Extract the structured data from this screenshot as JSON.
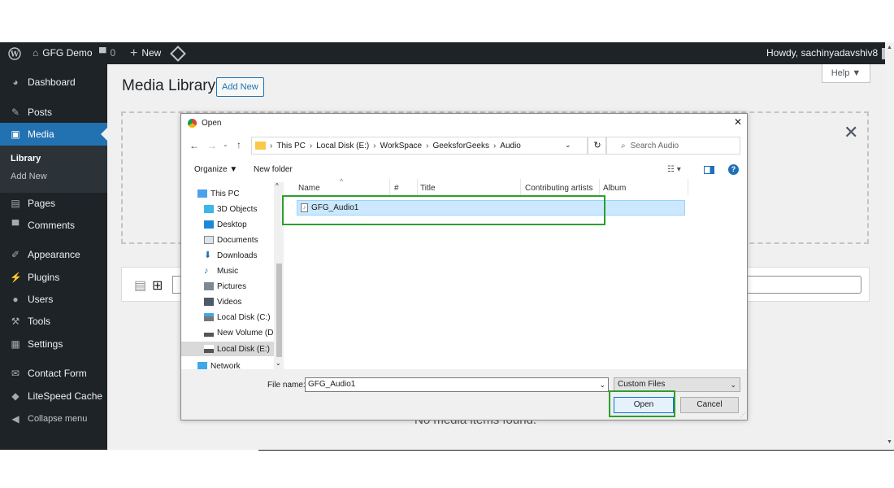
{
  "adminbar": {
    "site_name": "GFG Demo",
    "comments_count": "0",
    "new_label": "New",
    "howdy": "Howdy, sachinyadavshiv8"
  },
  "sidebar": {
    "items": [
      {
        "label": "Dashboard",
        "icon": "dashboard-icon"
      },
      {
        "label": "Posts",
        "icon": "pin-icon"
      },
      {
        "label": "Media",
        "icon": "media-icon"
      },
      {
        "label": "Pages",
        "icon": "pages-icon"
      },
      {
        "label": "Comments",
        "icon": "comments-icon"
      },
      {
        "label": "Appearance",
        "icon": "brush-icon"
      },
      {
        "label": "Plugins",
        "icon": "plugin-icon"
      },
      {
        "label": "Users",
        "icon": "users-icon"
      },
      {
        "label": "Tools",
        "icon": "wrench-icon"
      },
      {
        "label": "Settings",
        "icon": "settings-icon"
      },
      {
        "label": "Contact Form",
        "icon": "mail-icon"
      },
      {
        "label": "LiteSpeed Cache",
        "icon": "diamond-icon"
      },
      {
        "label": "Collapse menu",
        "icon": "collapse-icon"
      }
    ],
    "submenu": [
      "Library",
      "Add New"
    ]
  },
  "main": {
    "title": "Media Library",
    "add_new": "Add New",
    "help": "Help ▼",
    "no_items": "No media items found."
  },
  "dialog": {
    "title": "Open",
    "breadcrumb": [
      "This PC",
      "Local Disk (E:)",
      "WorkSpace",
      "GeeksforGeeks",
      "Audio"
    ],
    "search_placeholder": "Search Audio",
    "organize": "Organize ▼",
    "new_folder": "New folder",
    "tree": [
      "This PC",
      "3D Objects",
      "Desktop",
      "Documents",
      "Downloads",
      "Music",
      "Pictures",
      "Videos",
      "Local Disk (C:)",
      "New Volume (D:",
      "Local Disk (E:)",
      "Network"
    ],
    "columns": [
      "Name",
      "#",
      "Title",
      "Contributing artists",
      "Album"
    ],
    "files": [
      "GFG_Audio1"
    ],
    "filename_label": "File name:",
    "filename_value": "GFG_Audio1",
    "filetype": "Custom Files",
    "open_btn": "Open",
    "cancel_btn": "Cancel"
  },
  "colors": {
    "admin_dark": "#1d2327",
    "wp_blue": "#2271b1",
    "highlight_green": "#2e9e2e",
    "selection_blue": "#cce8ff"
  }
}
